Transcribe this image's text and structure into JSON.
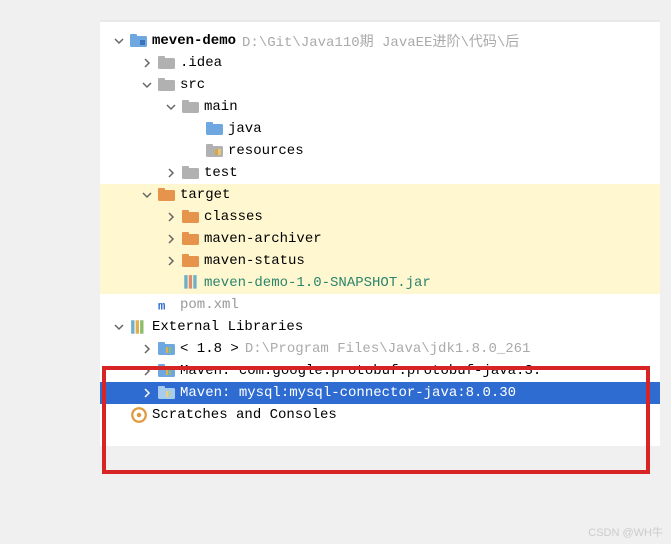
{
  "tree": {
    "root": {
      "label": "meven-demo",
      "path": "D:\\Git\\Java110期 JavaEE进阶\\代码\\后"
    },
    "idea": {
      "label": ".idea"
    },
    "src": {
      "label": "src"
    },
    "main": {
      "label": "main"
    },
    "java": {
      "label": "java"
    },
    "resources": {
      "label": "resources"
    },
    "test": {
      "label": "test"
    },
    "target": {
      "label": "target"
    },
    "classes": {
      "label": "classes"
    },
    "maven_archiver": {
      "label": "maven-archiver"
    },
    "maven_status": {
      "label": "maven-status"
    },
    "snapshot_jar": {
      "label": "meven-demo-1.0-SNAPSHOT.jar"
    },
    "pom_xml": {
      "label": "pom.xml"
    },
    "external_libs": {
      "label": "External Libraries"
    },
    "jdk": {
      "label": "< 1.8 >",
      "path": "D:\\Program Files\\Java\\jdk1.8.0_261"
    },
    "protobuf": {
      "prefix": "Maven: ",
      "label": "com.google.protobuf:protobuf-java:3."
    },
    "mysql": {
      "prefix": "Maven: ",
      "label": "mysql:mysql-connector-java:8.0.30"
    },
    "scratches": {
      "label": "Scratches and Consoles"
    }
  },
  "watermark": "CSDN @WH牛"
}
